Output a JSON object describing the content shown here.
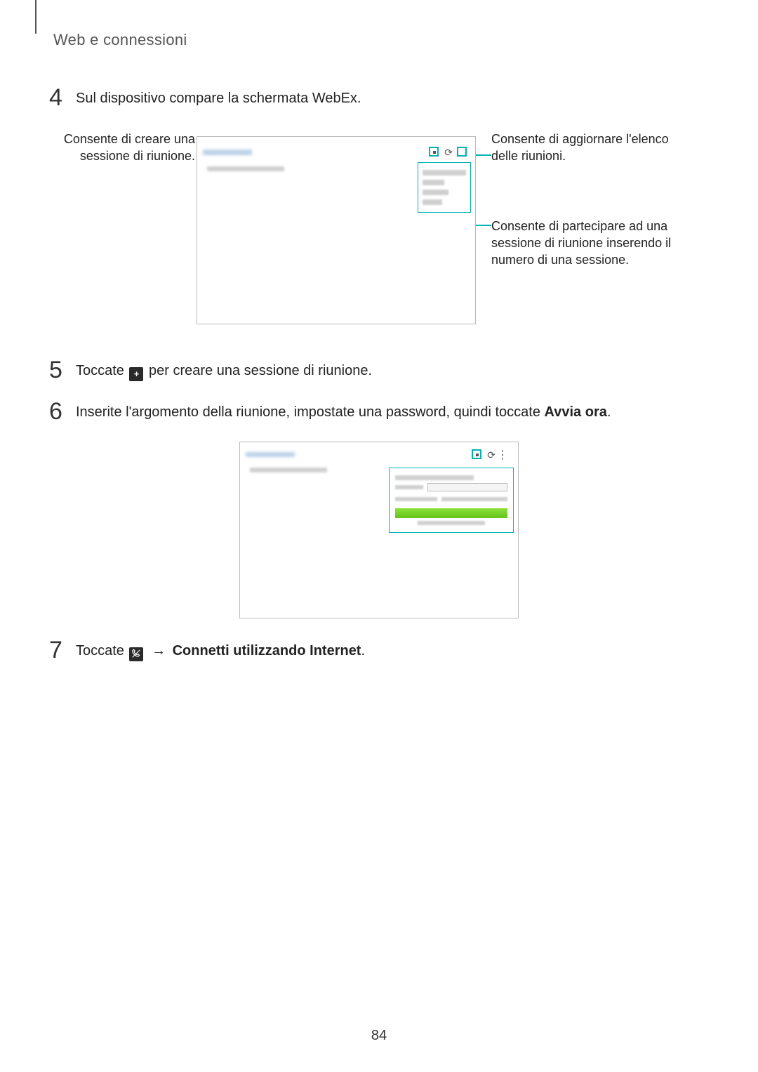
{
  "header": "Web e connessioni",
  "steps": {
    "s4": {
      "num": "4",
      "text": "Sul dispositivo compare la schermata WebEx."
    },
    "s5": {
      "num": "5",
      "before": "Toccate ",
      "after": " per creare una sessione di riunione."
    },
    "s6": {
      "num": "6",
      "before": "Inserite l'argomento della riunione, impostate una password, quindi toccate ",
      "bold": "Avvia ora",
      "end": "."
    },
    "s7": {
      "num": "7",
      "before": "Toccate ",
      "arrow": "→",
      "bold": " Connetti utilizzando Internet",
      "end": "."
    }
  },
  "callouts": {
    "left1": "Consente di creare una sessione di riunione.",
    "right1": "Consente di aggiornare l'elenco delle riunioni.",
    "right2": "Consente di partecipare ad una sessione di riunione inserendo il numero di una sessione."
  },
  "page_number": "84"
}
